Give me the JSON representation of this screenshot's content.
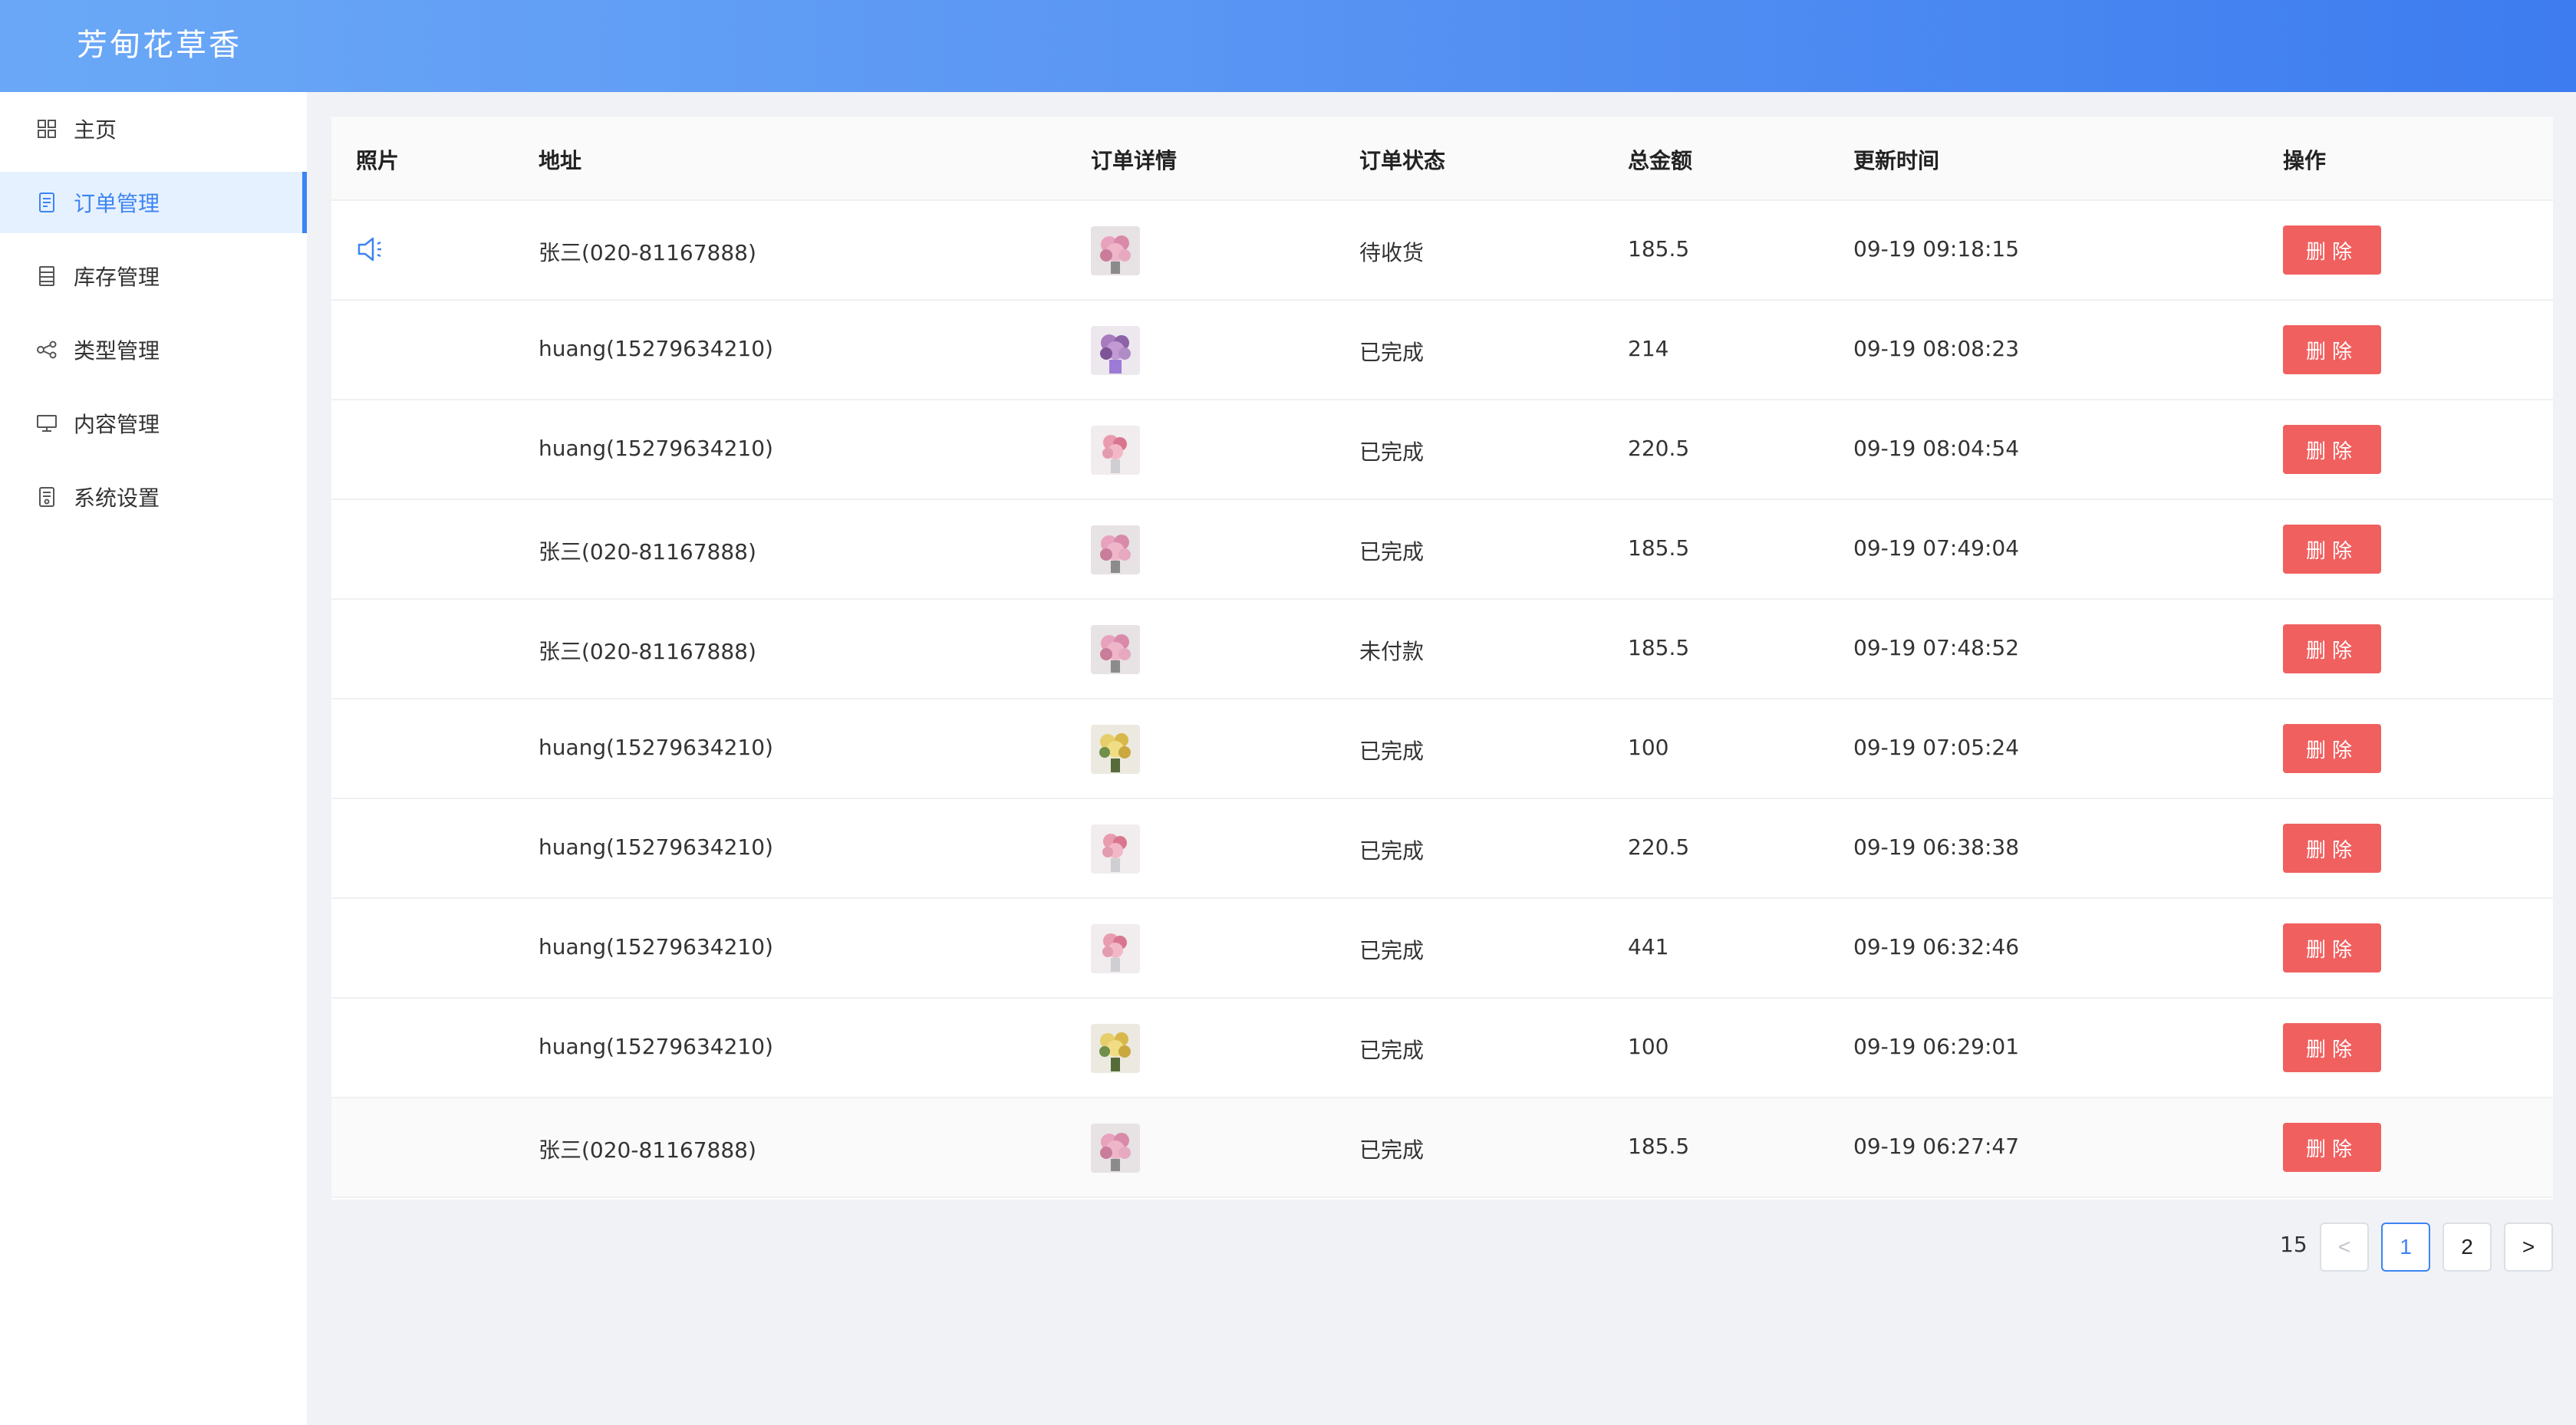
{
  "app": {
    "title": "芳甸花草香"
  },
  "sidebar": {
    "items": [
      {
        "label": "主页",
        "icon": "grid-icon"
      },
      {
        "label": "订单管理",
        "icon": "document-icon",
        "active": true
      },
      {
        "label": "库存管理",
        "icon": "list-icon"
      },
      {
        "label": "类型管理",
        "icon": "share-nodes-icon"
      },
      {
        "label": "内容管理",
        "icon": "monitor-icon"
      },
      {
        "label": "系统设置",
        "icon": "settings-document-icon"
      }
    ]
  },
  "table": {
    "columns": [
      "照片",
      "地址",
      "订单详情",
      "订单状态",
      "总金额",
      "更新时间",
      "操作"
    ],
    "rows": [
      {
        "address": "张三(020-81167888)",
        "status": "待收货",
        "amount": "185.5",
        "time": "09-19 09:18:15",
        "thumb": "pink"
      },
      {
        "address": "huang(15279634210)",
        "status": "已完成",
        "amount": "214",
        "time": "09-19 08:08:23",
        "thumb": "purple"
      },
      {
        "address": "huang(15279634210)",
        "status": "已完成",
        "amount": "220.5",
        "time": "09-19 08:04:54",
        "thumb": "rose"
      },
      {
        "address": "张三(020-81167888)",
        "status": "已完成",
        "amount": "185.5",
        "time": "09-19 07:49:04",
        "thumb": "pink"
      },
      {
        "address": "张三(020-81167888)",
        "status": "未付款",
        "amount": "185.5",
        "time": "09-19 07:48:52",
        "thumb": "pink"
      },
      {
        "address": "huang(15279634210)",
        "status": "已完成",
        "amount": "100",
        "time": "09-19 07:05:24",
        "thumb": "yellow"
      },
      {
        "address": "huang(15279634210)",
        "status": "已完成",
        "amount": "220.5",
        "time": "09-19 06:38:38",
        "thumb": "rose"
      },
      {
        "address": "huang(15279634210)",
        "status": "已完成",
        "amount": "441",
        "time": "09-19 06:32:46",
        "thumb": "rose"
      },
      {
        "address": "huang(15279634210)",
        "status": "已完成",
        "amount": "100",
        "time": "09-19 06:29:01",
        "thumb": "yellow"
      },
      {
        "address": "张三(020-81167888)",
        "status": "已完成",
        "amount": "185.5",
        "time": "09-19 06:27:47",
        "thumb": "pink"
      }
    ],
    "delete_label": "删除"
  },
  "pagination": {
    "total": "15",
    "pages": [
      "1",
      "2"
    ],
    "current": "1",
    "prev": "<",
    "next": ">"
  },
  "colors": {
    "accent": "#3d84f2",
    "danger": "#f0605f",
    "header_start": "#6aa8f7",
    "header_end": "#3d7cf0"
  }
}
